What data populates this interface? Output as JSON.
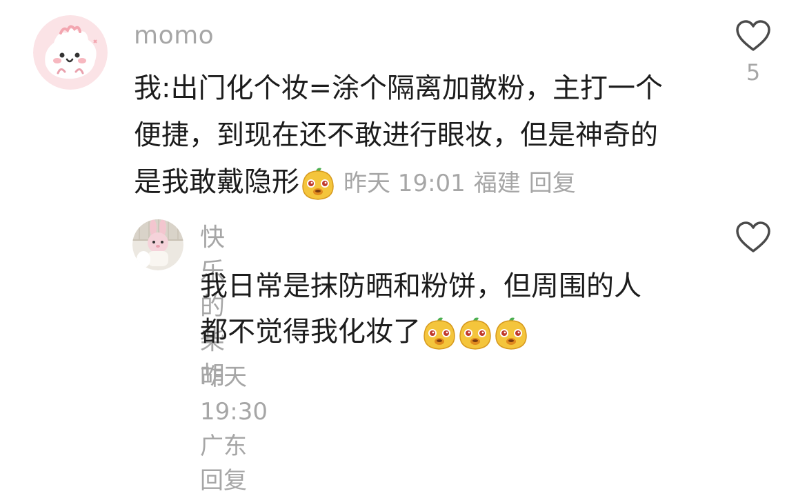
{
  "comments": [
    {
      "author": "momo",
      "lines": [
        "我:出门化个妆=涂个隔离加散粉，主打一个",
        "便捷，到现在还不敢进行眼妆，但是神奇的",
        "是我敢戴隐形"
      ],
      "emojis": [
        "duck-emoji"
      ],
      "time": "昨天 19:01",
      "location": "福建",
      "reply_label": "回复",
      "like_count": "5"
    },
    {
      "author": "快乐的柴胡",
      "lines": [
        "我日常是抹防晒和粉饼，但周围的人",
        "都不觉得我化妆了"
      ],
      "emojis": [
        "duck-emoji",
        "duck-emoji",
        "duck-emoji"
      ],
      "time": "昨天 19:30",
      "location": "广东",
      "reply_label": "回复",
      "like_count": ""
    }
  ],
  "colors": {
    "text_primary": "#1c1c1c",
    "text_secondary": "#a6a6a6",
    "avatar_pink": "#fbe3e6",
    "emoji_yellow": "#f4c53c"
  }
}
